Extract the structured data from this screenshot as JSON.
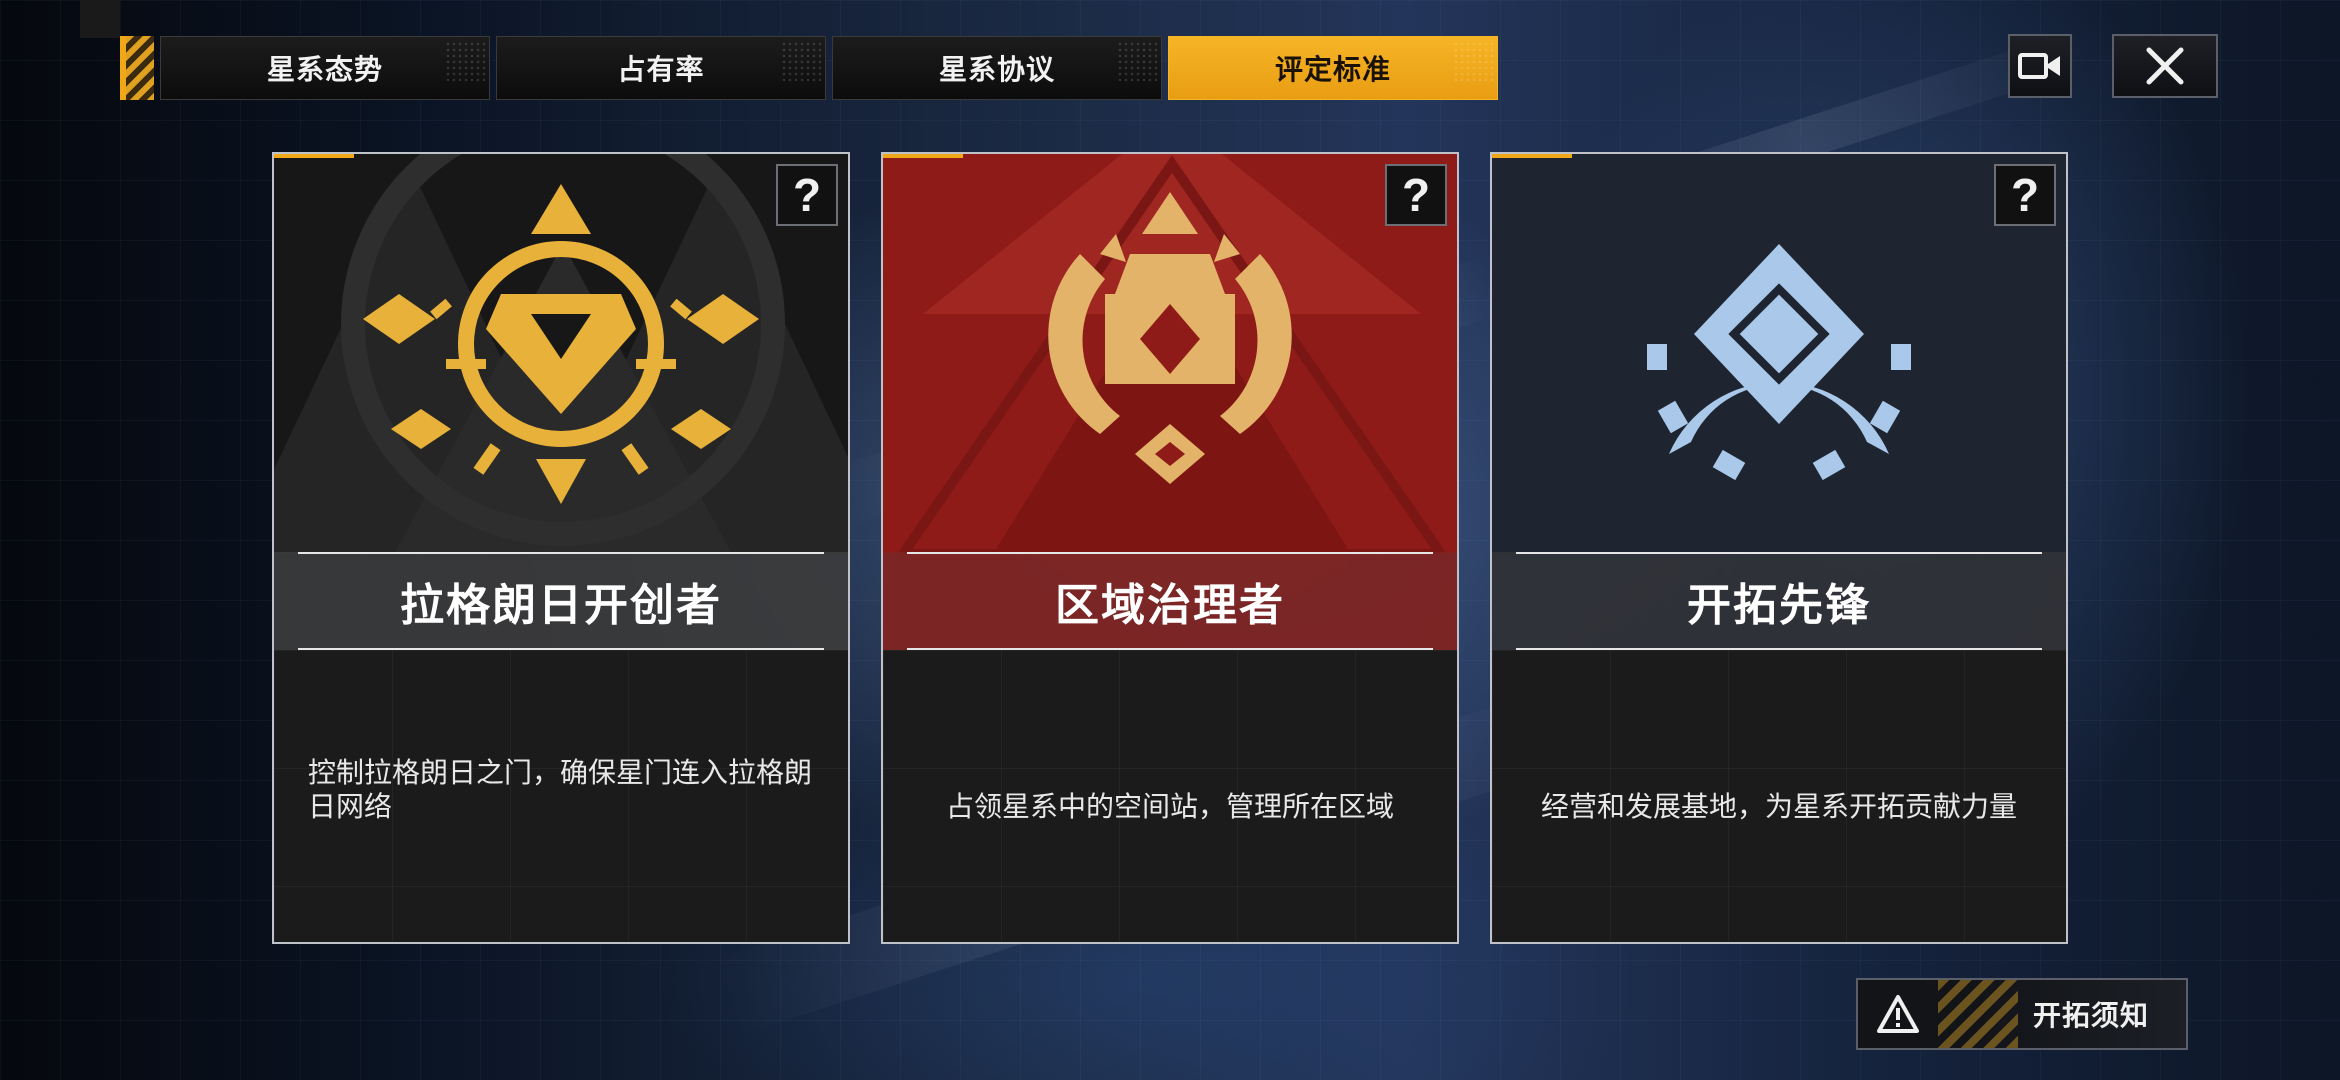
{
  "tabs": [
    {
      "label": "星系态势",
      "active": false
    },
    {
      "label": "占有率",
      "active": false
    },
    {
      "label": "星系协议",
      "active": false
    },
    {
      "label": "评定标准",
      "active": true
    }
  ],
  "top_buttons": {
    "video_icon": "video-camera-icon",
    "close_icon": "close-icon"
  },
  "cards": [
    {
      "title": "拉格朗日开创者",
      "description": "控制拉格朗日之门，确保星门连入拉格朗日网络",
      "help_glyph": "?",
      "emblem_color": "#e8b23a",
      "theme": "#171717"
    },
    {
      "title": "区域治理者",
      "description": "占领星系中的空间站，管理所在区域",
      "help_glyph": "?",
      "emblem_color": "#e3b36a",
      "theme": "#8f1b18"
    },
    {
      "title": "开拓先锋",
      "description": "经营和发展基地，为星系开拓贡献力量",
      "help_glyph": "?",
      "emblem_color": "#a9c8ea",
      "theme": "#1e2530"
    }
  ],
  "notice_button": {
    "label": "开拓须知",
    "icon": "warning-icon"
  },
  "accent_color": "#f0a818"
}
